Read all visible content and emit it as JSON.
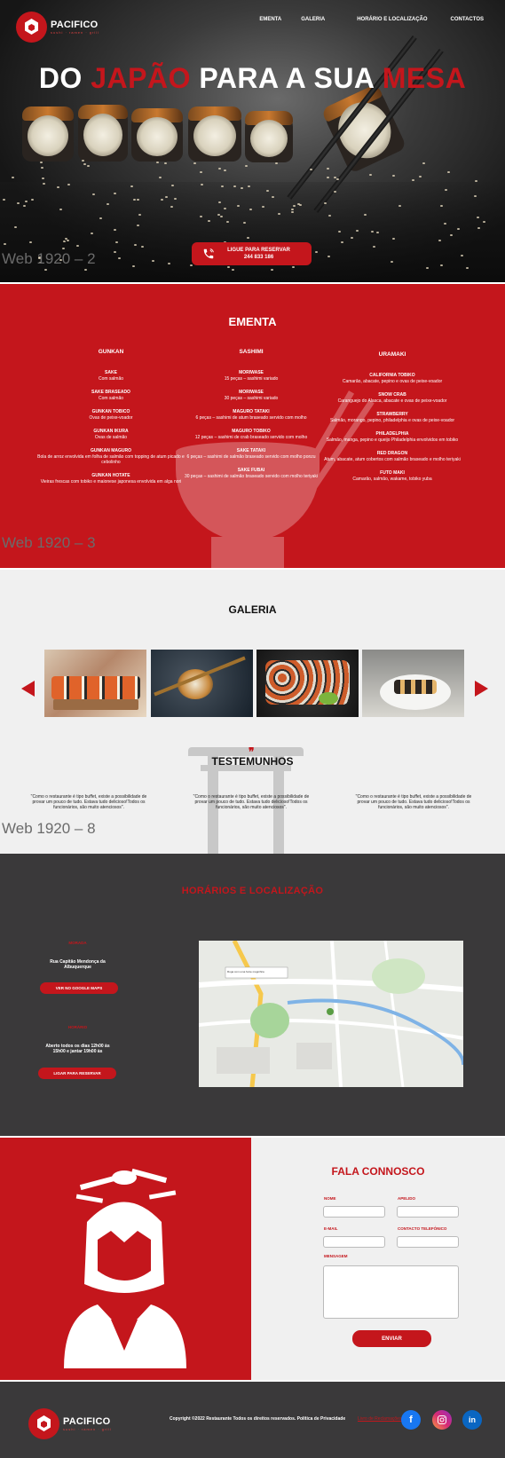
{
  "brand": {
    "name": "PACIFICO",
    "tagline": "sushi · ramen · grill"
  },
  "nav": [
    "EMENTA",
    "GALERIA",
    "HORÁRIO E LOCALIZAÇÃO",
    "CONTACTOS"
  ],
  "hero": {
    "title_parts": [
      "DO ",
      "JAPÃO",
      " PARA A SUA ",
      "MESA"
    ],
    "reserve_label": "LIGUE PARA RESERVAR",
    "reserve_phone": "244 833 186",
    "frame_label": "Web 1920 – 2"
  },
  "ementa": {
    "title": "EMENTA",
    "frame_label": "Web 1920 – 3",
    "columns": [
      {
        "head": "GUNKAN",
        "items": [
          {
            "name": "SAKE",
            "desc": "Com salmão"
          },
          {
            "name": "SAKE BRASEADO",
            "desc": "Com salmão"
          },
          {
            "name": "GUNKAN TOBICO",
            "desc": "Ovas de peixe-voador"
          },
          {
            "name": "GUNKAN IKURA",
            "desc": "Ovas de salmão"
          },
          {
            "name": "GUNKAN MAGURO",
            "desc": "Bola de arroz envolvida em folha de salmão com topping de atum picado e cebolinho"
          },
          {
            "name": "GUNKAN HOTATE",
            "desc": "Vieiras frescas com tobiko e maionese japonesa envolvida em alga nori"
          }
        ]
      },
      {
        "head": "SASHIMI",
        "items": [
          {
            "name": "MORIWASE",
            "desc": "15 peças – sashimi variado"
          },
          {
            "name": "MORIWASE",
            "desc": "30 peças – sashimi variado"
          },
          {
            "name": "MAGURO TATAKI",
            "desc": "6 peças – sashimi de atum braseado servido com molho"
          },
          {
            "name": "MAGURO TOBIKO",
            "desc": "12 peças – sashimi de crab braseado servido com molho"
          },
          {
            "name": "SAKE TATAKI",
            "desc": "6 peças – sashimi de salmão braseado servido com molho ponzu"
          },
          {
            "name": "SAKE FUBAI",
            "desc": "30 peças – sashimi de salmão braseado servido com molho teriyaki"
          }
        ]
      },
      {
        "head": "URAMAKI",
        "items": [
          {
            "name": "CALIFORNIA TOBIKO",
            "desc": "Camarão, abacate, pepino e ovas de peixe-voador"
          },
          {
            "name": "SNOW CRAB",
            "desc": "Caranguejo do Alasca, abacate e ovas de peixe-voador"
          },
          {
            "name": "STRAWBERRY",
            "desc": "Salmão, morango, pepino, philadelphia e ovas de peixe-voador"
          },
          {
            "name": "PHILADELPHIA",
            "desc": "Salmão, manga, pepino e queijo Philadelphia envolvidos em tobiko"
          },
          {
            "name": "RED DRAGON",
            "desc": "Atum, abacate, atum cobertos com salmão braseado e molho teriyaki"
          },
          {
            "name": "FUTO MAKI",
            "desc": "Camarão, salmão, wakame, tobiko yuba"
          }
        ]
      }
    ]
  },
  "galeria": {
    "title": "GALERIA",
    "frame_label": "Web 1920 – 8",
    "testimonials_title": "TESTEMUNHOS",
    "quote_mark": "❞",
    "testimonials": [
      "\"Como o restaurante é tipo buffet, existe a possibilidade de provar um pouco de tudo. Estava tudo delicioso!Todos os funcionários, são muito atenciosos\".",
      "\"Como o restaurante é tipo buffet, existe a possibilidade de provar um pouco de tudo. Estava tudo delicioso!Todos os funcionários, são muito atenciosos\".",
      "\"Como o restaurante é tipo buffet, existe a possibilidade de provar um pouco de tudo. Estava tudo delicioso!Todos os funcionários, são muito atenciosos\"."
    ]
  },
  "horarios": {
    "title": "HORÁRIOS E LOCALIZAÇÃO",
    "morada_label": "MORADA",
    "morada": "Rua Capitão Mendonça da Albuquerque",
    "maps_btn": "VER NO GOOGLE MAPS",
    "horario_label": "HORÁRIO",
    "horario": "Aberto todos os dias 12h00 às 15h00 e jantar 19h00 às",
    "reserve_btn": "LIGAR PARA RESERVAR",
    "map_tooltip": "Ruga com uma fonte magnífica"
  },
  "contact": {
    "title": "FALA CONNOSCO",
    "labels": {
      "nome": "NOME",
      "apelido": "APELIDO",
      "email": "E-MAIL",
      "telefone": "CONTACTO TELEFÓNICO",
      "mensagem": "MENSAGEM"
    },
    "send": "ENVIAR"
  },
  "footer": {
    "copyright": "Copyright ©2022 Restaurante Todos os direitos reservados. Política de Privacidade",
    "extra_link": "Livro de Reclamações"
  },
  "colors": {
    "accent": "#c4161c",
    "dark": "#3a393a",
    "light": "#f0f0f0"
  }
}
